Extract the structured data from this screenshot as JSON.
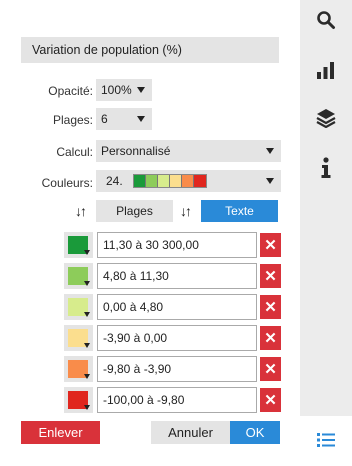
{
  "panel": {
    "title": "Variation de population (%)",
    "opacity": {
      "label": "Opacité:",
      "value": "100%"
    },
    "ranges": {
      "label": "Plages:",
      "value": "6"
    },
    "calc": {
      "label": "Calcul:",
      "value": "Personnalisé"
    },
    "colors": {
      "label": "Couleurs:",
      "value": "24.",
      "palette": [
        "#1a9a3a",
        "#8dcc5a",
        "#d7ec8c",
        "#fbde8e",
        "#f98c4a",
        "#e0261e"
      ]
    },
    "tabs": {
      "plages": "Plages",
      "texte": "Texte"
    },
    "classes": [
      {
        "color": "#1a9a3a",
        "range": "11,30 à 30 300,00"
      },
      {
        "color": "#8dcc5a",
        "range": "4,80 à 11,30"
      },
      {
        "color": "#d7ec8c",
        "range": "0,00 à 4,80"
      },
      {
        "color": "#fbde8e",
        "range": "-3,90 à 0,00"
      },
      {
        "color": "#f98c4a",
        "range": "-9,80 à -3,90"
      },
      {
        "color": "#e0261e",
        "range": "-100,00 à -9,80"
      }
    ],
    "buttons": {
      "remove": "Enlever",
      "cancel": "Annuler",
      "ok": "OK"
    }
  },
  "toolbar": {
    "icons": [
      "search-icon",
      "bar-chart-icon",
      "layers-icon",
      "info-icon",
      "legend-list-icon"
    ],
    "accent": "#2a8ad8"
  }
}
